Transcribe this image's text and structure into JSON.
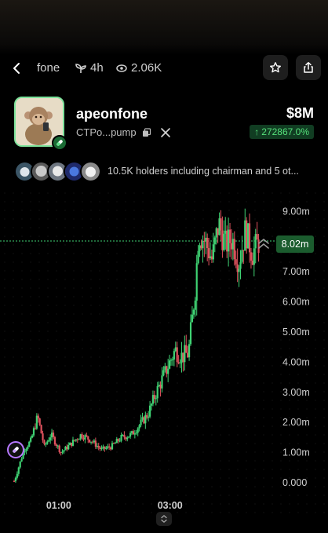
{
  "header": {
    "back_icon": "chevron-left-icon",
    "title": "fone",
    "age": "4h",
    "views": "2.06K",
    "star_icon": "star-icon",
    "share_icon": "share-icon"
  },
  "token": {
    "name": "apeonfone",
    "address": "CTPo...pump",
    "copy_icon": "copy-icon",
    "x_icon": "x-logo-icon",
    "market_cap": "$8M",
    "change": "272867.0%",
    "change_arrow": "↑",
    "change_color": "#55e07a"
  },
  "holders": {
    "text": "10.5K holders including chairman and 5 ot..."
  },
  "chart_data": {
    "type": "candlestick",
    "x_ticks": [
      "01:00",
      "03:00"
    ],
    "y_ticks": [
      "9.00m",
      "8.00m",
      "7.00m",
      "6.00m",
      "5.00m",
      "4.00m",
      "3.00m",
      "2.00m",
      "1.00m",
      "0.000"
    ],
    "ylim": [
      0,
      9.5
    ],
    "current_price": "8.02m",
    "current_value": 8.02,
    "up_color": "#3fd273",
    "down_color": "#e0525e",
    "price_series": [
      {
        "t": 0,
        "v": 0.05
      },
      {
        "t": 3,
        "v": 1.1
      },
      {
        "t": 5,
        "v": 1.4
      },
      {
        "t": 7,
        "v": 2.2
      },
      {
        "t": 9,
        "v": 1.2
      },
      {
        "t": 11,
        "v": 1.6
      },
      {
        "t": 14,
        "v": 1.0
      },
      {
        "t": 17,
        "v": 1.3
      },
      {
        "t": 20,
        "v": 1.6
      },
      {
        "t": 23,
        "v": 1.4
      },
      {
        "t": 26,
        "v": 1.1
      },
      {
        "t": 29,
        "v": 1.2
      },
      {
        "t": 32,
        "v": 1.5
      },
      {
        "t": 35,
        "v": 1.6
      },
      {
        "t": 38,
        "v": 2.0
      },
      {
        "t": 40,
        "v": 2.3
      },
      {
        "t": 42,
        "v": 2.9
      },
      {
        "t": 44,
        "v": 3.4
      },
      {
        "t": 46,
        "v": 3.9
      },
      {
        "t": 48,
        "v": 4.4
      },
      {
        "t": 50,
        "v": 4.2
      },
      {
        "t": 52,
        "v": 4.3
      },
      {
        "t": 54,
        "v": 6.4
      },
      {
        "t": 55,
        "v": 8.3
      },
      {
        "t": 57,
        "v": 8.0
      },
      {
        "t": 59,
        "v": 7.4
      },
      {
        "t": 61,
        "v": 8.6
      },
      {
        "t": 63,
        "v": 7.9
      },
      {
        "t": 65,
        "v": 8.1
      },
      {
        "t": 67,
        "v": 7.3
      },
      {
        "t": 69,
        "v": 8.4
      },
      {
        "t": 71,
        "v": 7.6
      },
      {
        "t": 73,
        "v": 8.02
      }
    ]
  }
}
